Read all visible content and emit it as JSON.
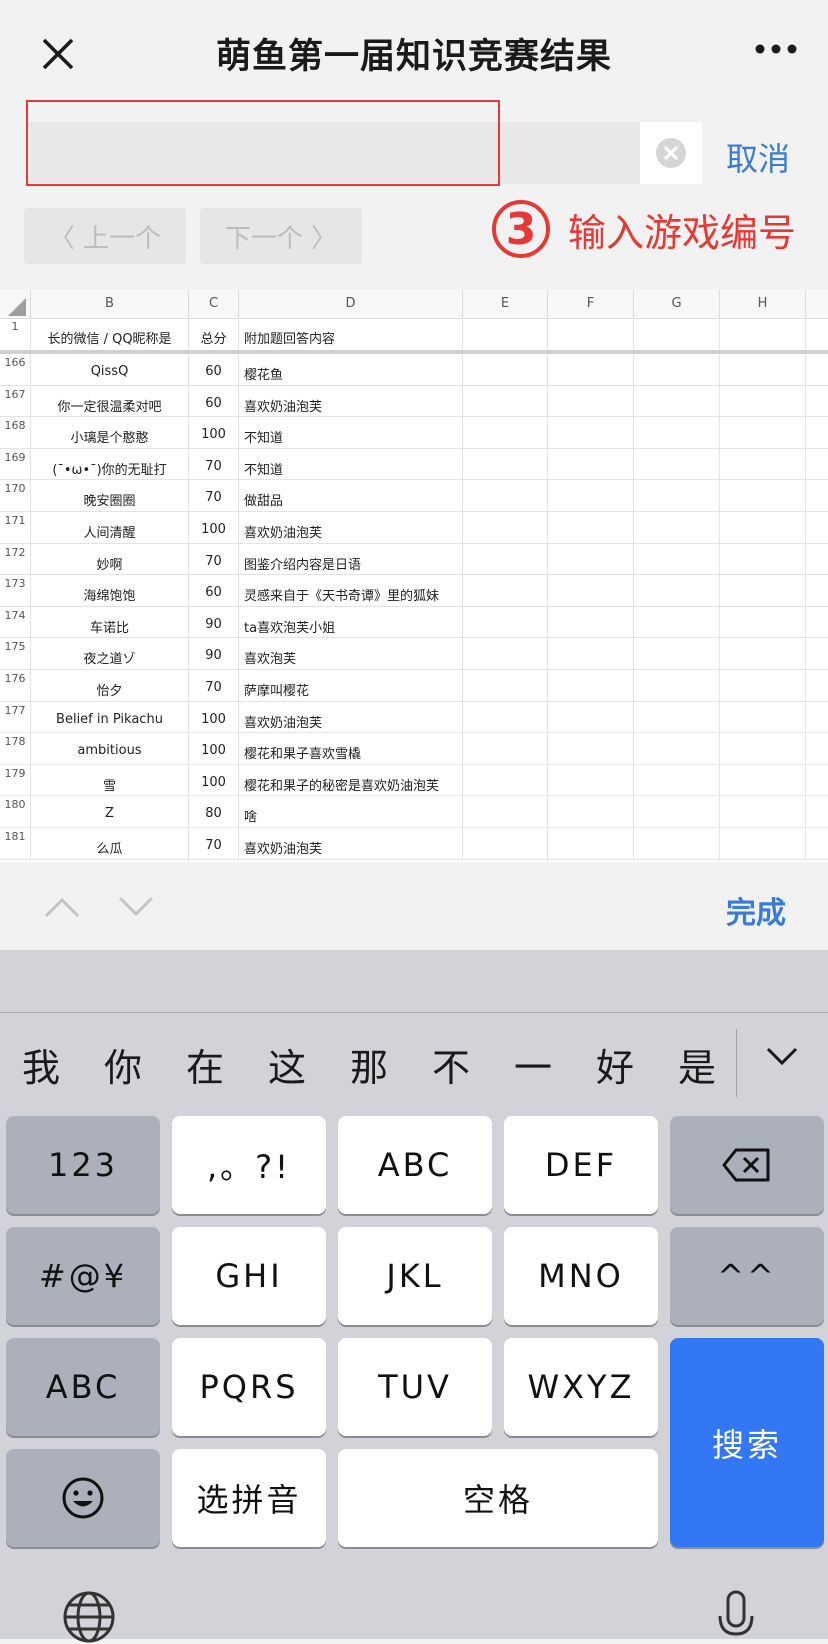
{
  "nav": {
    "title": "萌鱼第一届知识竞赛结果",
    "close_icon": "close-icon",
    "more_icon": "more-icon"
  },
  "search": {
    "value": "",
    "placeholder": "",
    "cancel_label": "取消",
    "prev_label": "〈 上一个",
    "next_label": "下一个 〉"
  },
  "annotation": {
    "number": "3",
    "text": "输入游戏编号",
    "color": "#e53935"
  },
  "sheet": {
    "columns": [
      "B",
      "C",
      "D",
      "E",
      "F",
      "G",
      "H"
    ],
    "header_row": {
      "num": "1",
      "b": "长的微信 / QQ昵称是",
      "c": "总分",
      "d": "附加题回答内容"
    },
    "rows": [
      {
        "num": "166",
        "b": "QissQ",
        "c": "60",
        "d": "樱花鱼"
      },
      {
        "num": "167",
        "b": "你一定很温柔对吧",
        "c": "60",
        "d": "喜欢奶油泡芙"
      },
      {
        "num": "168",
        "b": "小璃是个憨憨",
        "c": "100",
        "d": "不知道"
      },
      {
        "num": "169",
        "b": "(¯•ω•¯)你的无耻打",
        "c": "70",
        "d": "不知道"
      },
      {
        "num": "170",
        "b": "晚安圈圈",
        "c": "70",
        "d": "做甜品"
      },
      {
        "num": "171",
        "b": "人间清醒",
        "c": "100",
        "d": "喜欢奶油泡芙"
      },
      {
        "num": "172",
        "b": "妙啊",
        "c": "70",
        "d": "图鉴介绍内容是日语"
      },
      {
        "num": "173",
        "b": "海绵饱饱",
        "c": "60",
        "d": "灵感来自于《天书奇谭》里的狐妹"
      },
      {
        "num": "174",
        "b": "车诺比",
        "c": "90",
        "d": "ta喜欢泡芙小姐"
      },
      {
        "num": "175",
        "b": "夜之道ゾ",
        "c": "90",
        "d": "喜欢泡芙"
      },
      {
        "num": "176",
        "b": "怡夕",
        "c": "70",
        "d": "萨摩叫樱花"
      },
      {
        "num": "177",
        "b": "Belief in Pikachu",
        "c": "100",
        "d": "喜欢奶油泡芙"
      },
      {
        "num": "178",
        "b": "ambitious",
        "c": "100",
        "d": "樱花和果子喜欢雪橇"
      },
      {
        "num": "179",
        "b": "雪",
        "c": "100",
        "d": "樱花和果子的秘密是喜欢奶油泡芙"
      },
      {
        "num": "180",
        "b": "Z",
        "c": "80",
        "d": "啥"
      },
      {
        "num": "181",
        "b": "么瓜",
        "c": "70",
        "d": "喜欢奶油泡芙"
      }
    ]
  },
  "accessory": {
    "done_label": "完成"
  },
  "keyboard": {
    "candidates": [
      "我",
      "你",
      "在",
      "这",
      "那",
      "不",
      "一",
      "好",
      "是"
    ],
    "keys": {
      "num": "123",
      "punct": ",。?!",
      "abc_key": "ABC",
      "def": "DEF",
      "sym": "#@¥",
      "ghi": "GHI",
      "jkl": "JKL",
      "mno": "MNO",
      "caret": "^^",
      "abc2": "ABC",
      "pqrs": "PQRS",
      "tuv": "TUV",
      "wxyz": "WXYZ",
      "search": "搜索",
      "pinyin": "选拼音",
      "space": "空格"
    },
    "search_color": "#3477f5"
  }
}
